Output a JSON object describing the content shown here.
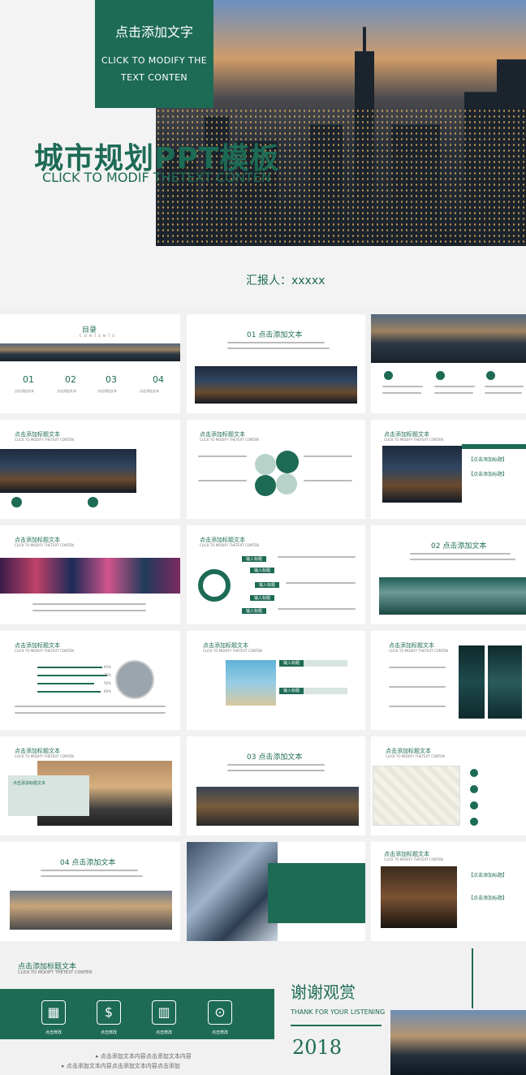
{
  "hero": {
    "box_title": "点击添加文字",
    "box_sub_1": "CLICK TO MODIFY THE",
    "box_sub_2": "TEXT CONTEN",
    "title": "城市规划PPT模板",
    "subtitle": "CLICK TO MODIF THETEXT CONTEN",
    "reporter": "汇报人：xxxxx"
  },
  "slides": {
    "toc": {
      "title": "目录",
      "en": "CONTENTS",
      "items": [
        "01",
        "02",
        "03",
        "04"
      ],
      "item_label": "点击添加文本"
    },
    "section1": {
      "title": "01 点击添加文本"
    },
    "section2": {
      "title": "02 点击添加文本"
    },
    "section3": {
      "title": "03 点击添加文本"
    },
    "section4": {
      "title": "04 点击添加文本"
    },
    "heading": "点击添加标题文本",
    "heading_en": "CLICK TO MODIFY THETEXT CONTEN",
    "input_title": "输入标题",
    "click_add_title": "【点击添加标题】",
    "progress": [
      "65%",
      "75%",
      "50%",
      "60%"
    ]
  },
  "final": {
    "title": "点击添加标题文本",
    "subtitle": "CLICK TO MODIFY THETEXT CONTEN",
    "icon_label": "点击修改",
    "bullet_1": "点击添加文本内容点击添加文本内容",
    "bullet_2": "点击添加文本内容点击添加文本内容点击添加",
    "thanks": "谢谢观赏",
    "thanks_en": "THANK FOR YOUR LISTENING",
    "year": "2018"
  },
  "icons": [
    "money-bills-icon",
    "money-bag-icon",
    "bar-chart-icon",
    "coin-search-icon"
  ],
  "colors": {
    "accent": "#1d6b55",
    "background": "#f1f1f1"
  }
}
